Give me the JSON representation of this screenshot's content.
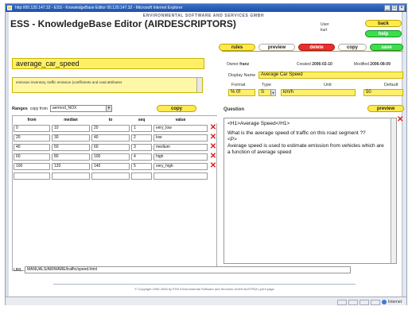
{
  "browser": {
    "title": "http://00.120.147.32 - ESS - KnowledgeBase Editor 00.120.147.32 - Microsoft Internet Explorer",
    "buttons": [
      "_",
      "□",
      "×"
    ],
    "status": "",
    "zone_label": "Internet"
  },
  "brand": "ENVIRONMENTAL SOFTWARE AND SERVICES GMBH",
  "app_title": "ESS - KnowledgeBase Editor (AIRDESCRIPTORS)",
  "user": {
    "label": "User",
    "name": "kurt"
  },
  "header_buttons": {
    "back": "back",
    "help": "help"
  },
  "toolbar": {
    "rules": "rules",
    "preview": "preview",
    "delete": "delete",
    "copy": "copy",
    "save": "save"
  },
  "descriptor": {
    "name": "average_car_speed",
    "description": "emission inventory, traffic emission (coefficients and road attributes",
    "owner_label": "Owner",
    "owner": "franz",
    "created_label": "Created",
    "created": "2006-02-10",
    "modified_label": "Modified",
    "modified": "2006-08-09",
    "display_name_label": "Display Name",
    "display_name": "Average Car Speed",
    "format_label": "Format",
    "format": "% 0f",
    "type_label": "Type",
    "type": "S",
    "unit_label": "Unit",
    "unit": "km/h",
    "default_label": "Default",
    "default": "50"
  },
  "ranges": {
    "label": "Ranges",
    "copy_from_label": "copy from",
    "copy_from_value": "aermod_NOX",
    "copy_button": "copy",
    "columns": [
      "from",
      "median",
      "to",
      "seq",
      "value"
    ],
    "rows": [
      [
        "0",
        "10",
        "20",
        "1",
        "very_low"
      ],
      [
        "20",
        "30",
        "40",
        "2",
        "low"
      ],
      [
        "40",
        "50",
        "60",
        "3",
        "medium"
      ],
      [
        "60",
        "80",
        "100",
        "4",
        "high"
      ],
      [
        "100",
        "120",
        "140",
        "5",
        "very_high"
      ],
      [
        "",
        "",
        "",
        "",
        ""
      ]
    ]
  },
  "question": {
    "label": "Question",
    "preview_button": "preview",
    "lines": [
      "<H1>Average Speed</H1>",
      "What is the average speed of traffic on this road segment ??",
      "<P>",
      "Average speed is used to estimate emission from vehicles which are a function of average speed"
    ]
  },
  "url": {
    "label": "URL",
    "value": "MANUALS/AIRWARE/traffic/speed.html"
  },
  "copyright": "© Copyright 1995-2006 by ESS Environmental Software and Services GmbH AUSTRIA | print page"
}
